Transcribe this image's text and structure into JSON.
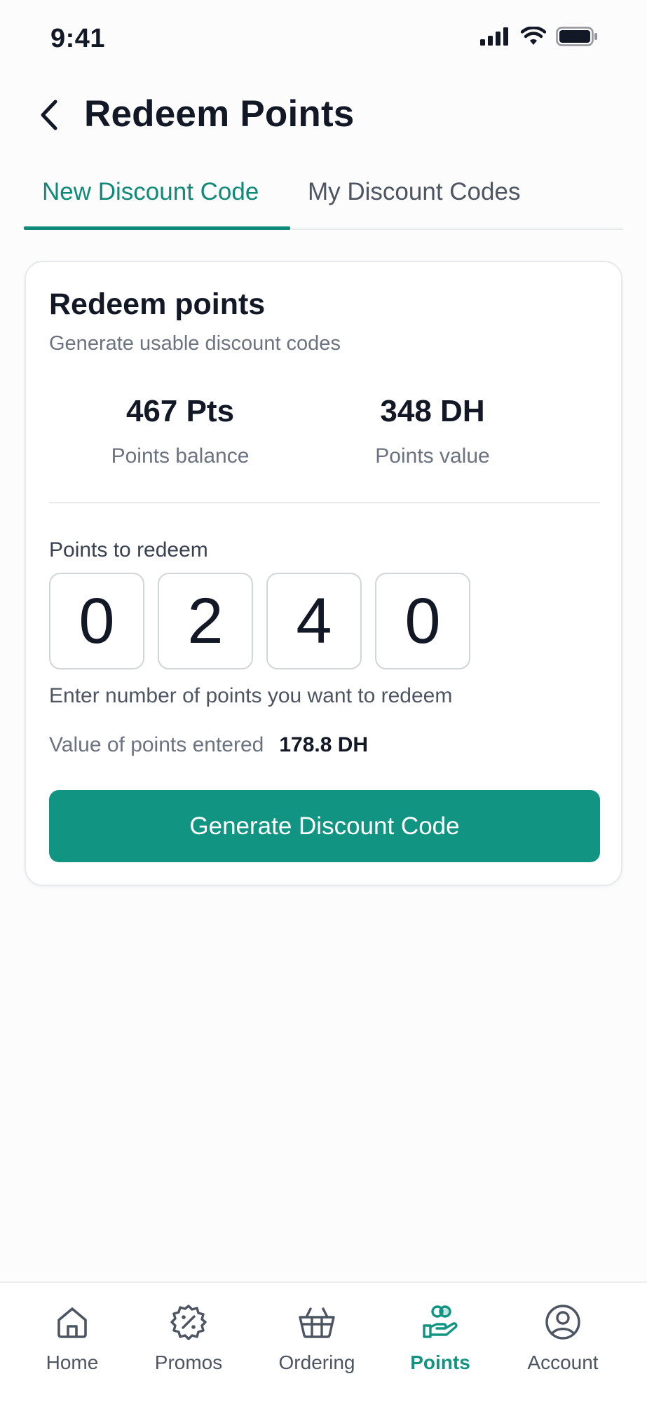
{
  "status_bar": {
    "time": "9:41"
  },
  "header": {
    "title": "Redeem Points"
  },
  "tabs": [
    {
      "label": "New Discount Code",
      "active": true
    },
    {
      "label": "My Discount Codes",
      "active": false
    }
  ],
  "card": {
    "title": "Redeem points",
    "subtitle": "Generate usable discount codes",
    "balance": {
      "value": "467 Pts",
      "label": "Points balance"
    },
    "points_value": {
      "value": "348 DH",
      "label": "Points value"
    },
    "redeem_label": "Points to redeem",
    "digits": [
      "0",
      "2",
      "4",
      "0"
    ],
    "helper_text": "Enter number of points you want to redeem",
    "value_entered_label": "Value of points entered",
    "value_entered": "178.8 DH",
    "generate_button_label": "Generate Discount Code"
  },
  "bottom_nav": [
    {
      "label": "Home",
      "icon": "home-icon"
    },
    {
      "label": "Promos",
      "icon": "discount-badge-icon"
    },
    {
      "label": "Ordering",
      "icon": "basket-icon"
    },
    {
      "label": "Points",
      "icon": "points-hand-icon",
      "active": true
    },
    {
      "label": "Account",
      "icon": "user-circle-icon"
    }
  ],
  "colors": {
    "accent": "#119582",
    "accent_text": "#0f8a78",
    "text_primary": "#121826",
    "text_secondary": "#6b7280",
    "nav_inactive": "#4d5562"
  }
}
